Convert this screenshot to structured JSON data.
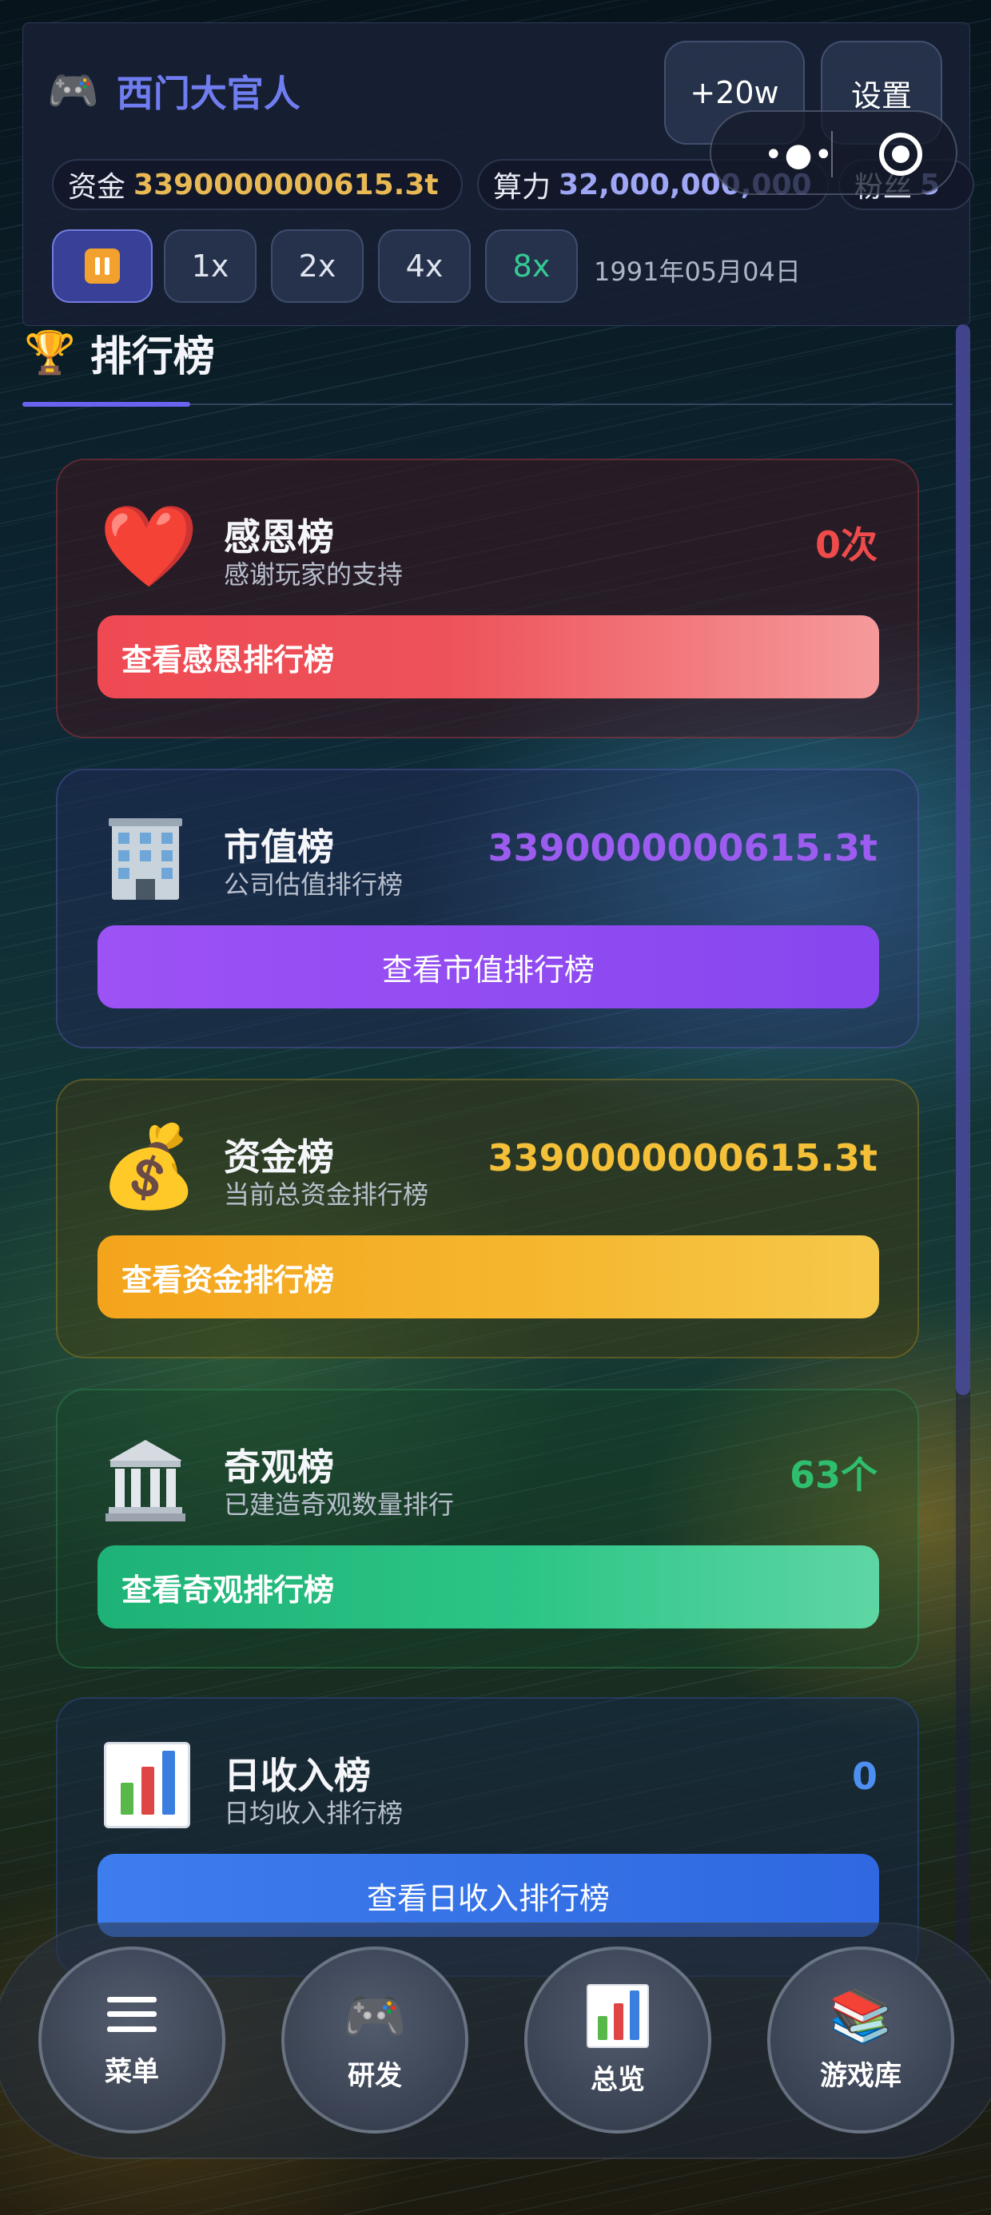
{
  "header": {
    "game_icon": "game-controller-icon",
    "title": "西门大官人",
    "add_button": "+20w",
    "settings_button": "设置",
    "stats": {
      "funds_label": "资金",
      "funds_value": "3390000000615.3t",
      "power_label": "算力",
      "power_value": "32,000,000,000",
      "fans_label": "粉丝",
      "fans_value": "5"
    },
    "speeds": [
      "1x",
      "2x",
      "4x",
      "8x"
    ],
    "active_speed": "8x",
    "date": "1991年05月04日"
  },
  "section": {
    "title": "排行榜",
    "icon": "trophy-icon"
  },
  "cards": [
    {
      "name": "感恩榜",
      "desc": "感谢玩家的支持",
      "value": "0次",
      "button": "查看感恩排行榜",
      "icon": "heart-icon",
      "color": "#ef4b4b"
    },
    {
      "name": "市值榜",
      "desc": "公司估值排行榜",
      "value": "3390000000615.3t",
      "button": "查看市值排行榜",
      "icon": "building-icon",
      "color": "#9d5cf0"
    },
    {
      "name": "资金榜",
      "desc": "当前总资金排行榜",
      "value": "3390000000615.3t",
      "button": "查看资金排行榜",
      "icon": "money-bag-icon",
      "color": "#f4c038"
    },
    {
      "name": "奇观榜",
      "desc": "已建造奇观数量排行",
      "value": "63个",
      "button": "查看奇观排行榜",
      "icon": "classical-building-icon",
      "color": "#2fbe6e"
    },
    {
      "name": "日收入榜",
      "desc": "日均收入排行榜",
      "value": "0",
      "button": "查看日收入排行榜",
      "icon": "bar-chart-icon",
      "color": "#4d8ff0"
    }
  ],
  "nav": [
    {
      "label": "菜单",
      "icon": "menu-icon"
    },
    {
      "label": "研发",
      "icon": "game-controller-icon"
    },
    {
      "label": "总览",
      "icon": "bar-chart-icon"
    },
    {
      "label": "游戏库",
      "icon": "books-icon"
    }
  ],
  "colors": {
    "accent": "#6a63f0",
    "title": "#6f7df0",
    "funds": "#e8b955",
    "power": "#9fa6f5"
  }
}
